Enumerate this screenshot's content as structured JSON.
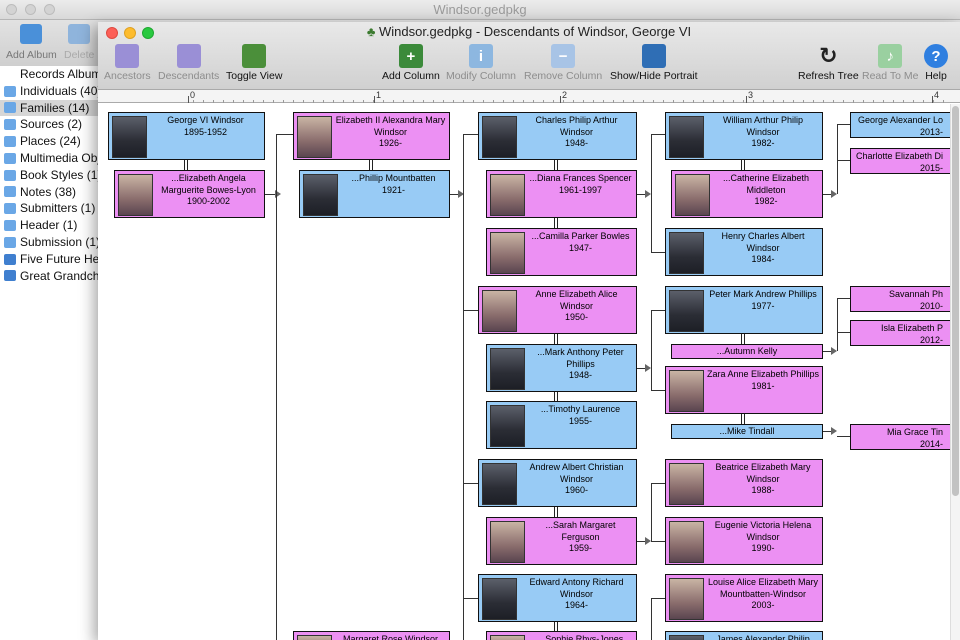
{
  "bg_window": {
    "title": "Windsor.gedpkg",
    "toolbar": [
      {
        "label": "Add Album",
        "icon": "add-album-icon",
        "disabled": false
      },
      {
        "label": "Delete",
        "icon": "delete-icon",
        "disabled": true
      }
    ]
  },
  "sidebar": {
    "items": [
      {
        "label": "Records Album",
        "icon": "",
        "selected": false
      },
      {
        "label": "Individuals (40)",
        "icon": "folder-icon",
        "selected": false
      },
      {
        "label": "Families (14)",
        "icon": "folder-icon",
        "selected": true
      },
      {
        "label": "Sources (2)",
        "icon": "folder-icon",
        "selected": false
      },
      {
        "label": "Places (24)",
        "icon": "folder-icon",
        "selected": false
      },
      {
        "label": "Multimedia Obj",
        "icon": "folder-icon",
        "selected": false
      },
      {
        "label": "Book Styles (1)",
        "icon": "folder-icon",
        "selected": false
      },
      {
        "label": "Notes (38)",
        "icon": "folder-icon",
        "selected": false
      },
      {
        "label": "Submitters (1)",
        "icon": "folder-icon",
        "selected": false
      },
      {
        "label": "Header (1)",
        "icon": "folder-icon",
        "selected": false
      },
      {
        "label": "Submission (1)",
        "icon": "folder-icon",
        "selected": false
      },
      {
        "label": "Five Future Heir",
        "icon": "album-icon",
        "selected": false
      },
      {
        "label": "Great Grandchi",
        "icon": "album-icon",
        "selected": false
      }
    ]
  },
  "window": {
    "title": "Windsor.gedpkg - Descendants of Windsor, George VI",
    "toolbar": [
      {
        "label": "Ancestors",
        "icon": "ancestors-icon",
        "disabled": true
      },
      {
        "label": "Descendants",
        "icon": "descendants-icon",
        "disabled": true
      },
      {
        "label": "Toggle View",
        "icon": "toggle-view-icon",
        "disabled": false
      },
      {
        "label": "Add Column",
        "icon": "add-column-icon",
        "disabled": false
      },
      {
        "label": "Modify Column",
        "icon": "modify-column-icon",
        "disabled": true
      },
      {
        "label": "Remove Column",
        "icon": "remove-column-icon",
        "disabled": true
      },
      {
        "label": "Show/Hide Portrait",
        "icon": "portrait-icon",
        "disabled": false
      },
      {
        "label": "Refresh Tree",
        "icon": "refresh-icon",
        "disabled": false
      },
      {
        "label": "Read To Me",
        "icon": "read-to-me-icon",
        "disabled": true
      },
      {
        "label": "Help",
        "icon": "help-icon",
        "disabled": false
      }
    ],
    "ruler_labels": [
      "0",
      "1",
      "2",
      "3",
      "4"
    ]
  },
  "colors": {
    "male": "#98cbf5",
    "female": "#ec90f3"
  },
  "tree": {
    "people": [
      {
        "name": "George VI Windsor",
        "dates": "1895-1952",
        "sex": "m",
        "photo": true
      },
      {
        "name": "...Elizabeth Angela Marguerite Bowes-Lyon",
        "dates": "1900-2002",
        "sex": "f",
        "photo": true
      },
      {
        "name": "Elizabeth II Alexandra Mary Windsor",
        "dates": "1926-",
        "sex": "f",
        "photo": true
      },
      {
        "name": "...Phillip Mountbatten",
        "dates": "1921-",
        "sex": "m",
        "photo": true
      },
      {
        "name": "Margaret Rose Windsor",
        "dates": "",
        "sex": "f",
        "photo": true
      },
      {
        "name": "Charles Philip Arthur Windsor",
        "dates": "1948-",
        "sex": "m",
        "photo": true
      },
      {
        "name": "...Diana Frances Spencer",
        "dates": "1961-1997",
        "sex": "f",
        "photo": true
      },
      {
        "name": "...Camilla Parker Bowles",
        "dates": "1947-",
        "sex": "f",
        "photo": true
      },
      {
        "name": "Anne Elizabeth Alice Windsor",
        "dates": "1950-",
        "sex": "f",
        "photo": true
      },
      {
        "name": "...Mark Anthony Peter Phillips",
        "dates": "1948-",
        "sex": "m",
        "photo": true
      },
      {
        "name": "...Timothy Laurence",
        "dates": "1955-",
        "sex": "m",
        "photo": true
      },
      {
        "name": "Andrew Albert Christian Windsor",
        "dates": "1960-",
        "sex": "m",
        "photo": true
      },
      {
        "name": "...Sarah Margaret Ferguson",
        "dates": "1959-",
        "sex": "f",
        "photo": true
      },
      {
        "name": "Edward Antony Richard Windsor",
        "dates": "1964-",
        "sex": "m",
        "photo": true
      },
      {
        "name": "...Sophie Rhys-Jones",
        "dates": "",
        "sex": "f",
        "photo": true
      },
      {
        "name": "William Arthur Philip Windsor",
        "dates": "1982-",
        "sex": "m",
        "photo": true
      },
      {
        "name": "...Catherine Elizabeth Middleton",
        "dates": "1982-",
        "sex": "f",
        "photo": true
      },
      {
        "name": "Henry Charles Albert Windsor",
        "dates": "1984-",
        "sex": "m",
        "photo": true
      },
      {
        "name": "Peter Mark Andrew Phillips",
        "dates": "1977-",
        "sex": "m",
        "photo": true
      },
      {
        "name": "...Autumn Kelly",
        "dates": "",
        "sex": "f",
        "photo": false
      },
      {
        "name": "Zara Anne Elizabeth Phillips",
        "dates": "1981-",
        "sex": "f",
        "photo": true
      },
      {
        "name": "...Mike Tindall",
        "dates": "",
        "sex": "m",
        "photo": false
      },
      {
        "name": "Beatrice Elizabeth Mary Windsor",
        "dates": "1988-",
        "sex": "f",
        "photo": true
      },
      {
        "name": "Eugenie Victoria Helena Windsor",
        "dates": "1990-",
        "sex": "f",
        "photo": true
      },
      {
        "name": "Louise Alice Elizabeth Mary Mountbatten-Windsor",
        "dates": "2003-",
        "sex": "f",
        "photo": true
      },
      {
        "name": "James Alexander Philip Theo",
        "dates": "",
        "sex": "m",
        "photo": true
      },
      {
        "name": "George Alexander Lo",
        "dates": "2013-",
        "sex": "m",
        "photo": false
      },
      {
        "name": "Charlotte Elizabeth Di",
        "dates": "2015-",
        "sex": "f",
        "photo": false
      },
      {
        "name": "Savannah Ph",
        "dates": "2010-",
        "sex": "f",
        "photo": false
      },
      {
        "name": "Isla Elizabeth P",
        "dates": "2012-",
        "sex": "f",
        "photo": false
      },
      {
        "name": "Mia Grace Tin",
        "dates": "2014-",
        "sex": "f",
        "photo": false
      }
    ]
  }
}
